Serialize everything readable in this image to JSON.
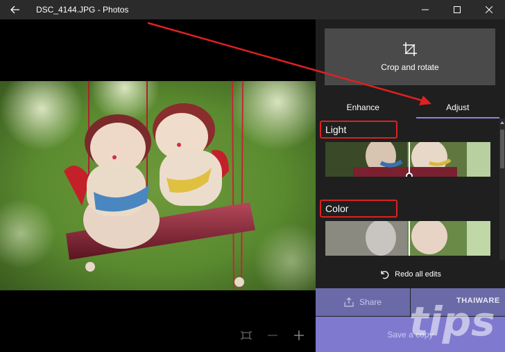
{
  "window": {
    "title": "DSC_4144.JPG - Photos"
  },
  "panel": {
    "crop_label": "Crop and rotate",
    "tabs": [
      {
        "label": "Enhance",
        "active": false
      },
      {
        "label": "Adjust",
        "active": true
      }
    ],
    "sections": {
      "light": "Light",
      "color": "Color"
    },
    "redo_label": "Redo all edits",
    "share_label": "Share",
    "save_label": "Save a copy"
  },
  "watermark": {
    "text": "THAIWARE",
    "tips": "tips"
  },
  "colors": {
    "accent": "#8a86d8",
    "highlight_box": "#e02020",
    "share_bg": "#6b6aa8",
    "save_bg": "#7f7ad0"
  },
  "icons": [
    "back-arrow-icon",
    "minimize-icon",
    "maximize-icon",
    "close-icon",
    "crop-icon",
    "fit-screen-icon",
    "zoom-out-icon",
    "zoom-in-icon",
    "undo-icon",
    "share-icon"
  ]
}
